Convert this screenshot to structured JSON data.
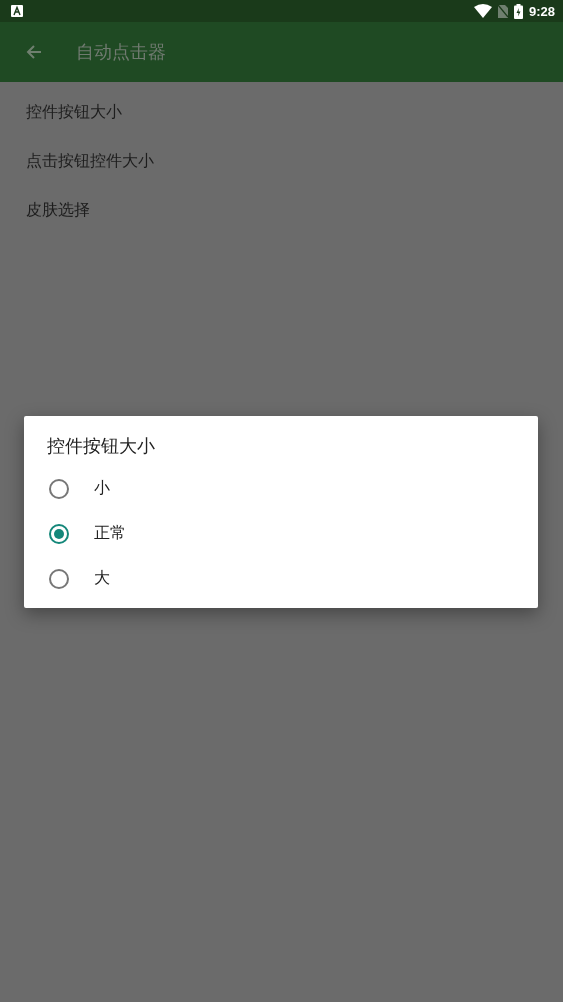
{
  "status_bar": {
    "time": "9:28"
  },
  "app_bar": {
    "title": "自动点击器"
  },
  "settings": [
    {
      "label": "控件按钮大小"
    },
    {
      "label": "点击按钮控件大小"
    },
    {
      "label": "皮肤选择"
    }
  ],
  "dialog": {
    "title": "控件按钮大小",
    "options": [
      {
        "label": "小",
        "selected": false
      },
      {
        "label": "正常",
        "selected": true
      },
      {
        "label": "大",
        "selected": false
      }
    ]
  }
}
